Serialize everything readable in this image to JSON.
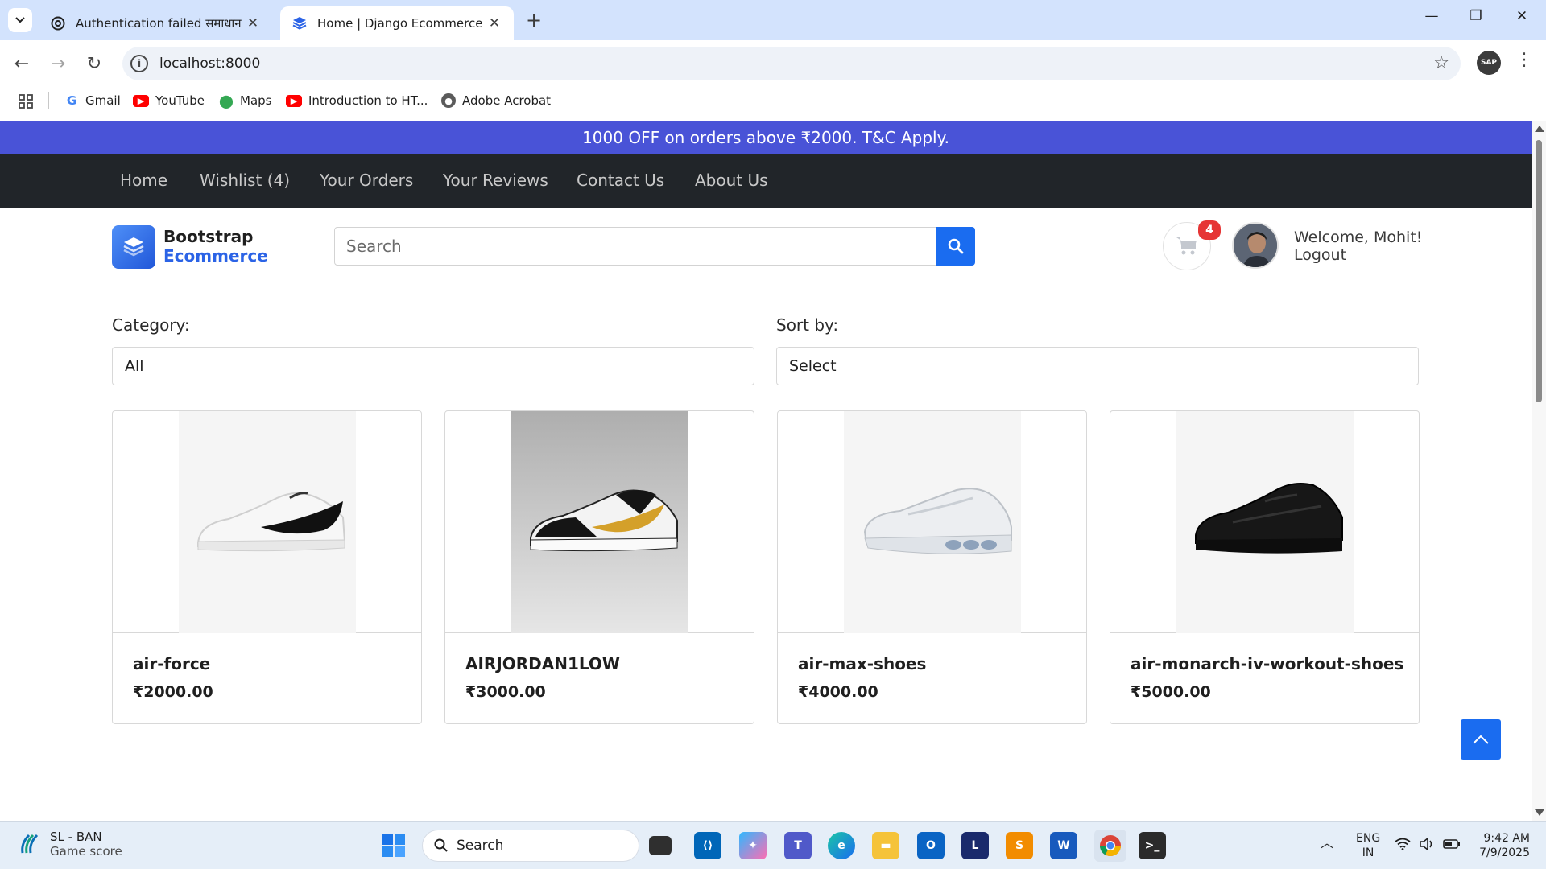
{
  "browser": {
    "tabs": [
      {
        "title": "Authentication failed समाधान",
        "active": false
      },
      {
        "title": "Home | Django Ecommerce Site",
        "active": true
      }
    ],
    "url": "localhost:8000",
    "profile_label": "SAP",
    "bookmarks": [
      {
        "label": "Gmail",
        "icon": "google-icon"
      },
      {
        "label": "YouTube",
        "icon": "youtube-icon"
      },
      {
        "label": "Maps",
        "icon": "maps-icon"
      },
      {
        "label": "Introduction to HT...",
        "icon": "youtube-icon"
      },
      {
        "label": "Adobe Acrobat",
        "icon": "globe-icon"
      }
    ]
  },
  "site": {
    "promo": "1000 OFF on orders above ₹2000. T&C Apply.",
    "nav": [
      "Home",
      "Wishlist (4)",
      "Your Orders",
      "Your Reviews",
      "Contact Us",
      "About Us"
    ],
    "brand_line1": "Bootstrap",
    "brand_line2": "Ecommerce",
    "search_placeholder": "Search",
    "cart_count": "4",
    "welcome": "Welcome, Mohit!",
    "logout": "Logout",
    "category_label": "Category:",
    "category_value": "All",
    "sort_label": "Sort by:",
    "sort_value": "Select",
    "products": [
      {
        "name": "air-force",
        "price": "₹2000.00"
      },
      {
        "name": "AIRJORDAN1LOW",
        "price": "₹3000.00"
      },
      {
        "name": "air-max-shoes",
        "price": "₹4000.00"
      },
      {
        "name": "air-monarch-iv-workout-shoes",
        "price": "₹5000.00"
      }
    ]
  },
  "taskbar": {
    "weather_title": "SL - BAN",
    "weather_sub": "Game score",
    "search": "Search",
    "lang1": "ENG",
    "lang2": "IN",
    "time": "9:42 AM",
    "date": "7/9/2025"
  }
}
